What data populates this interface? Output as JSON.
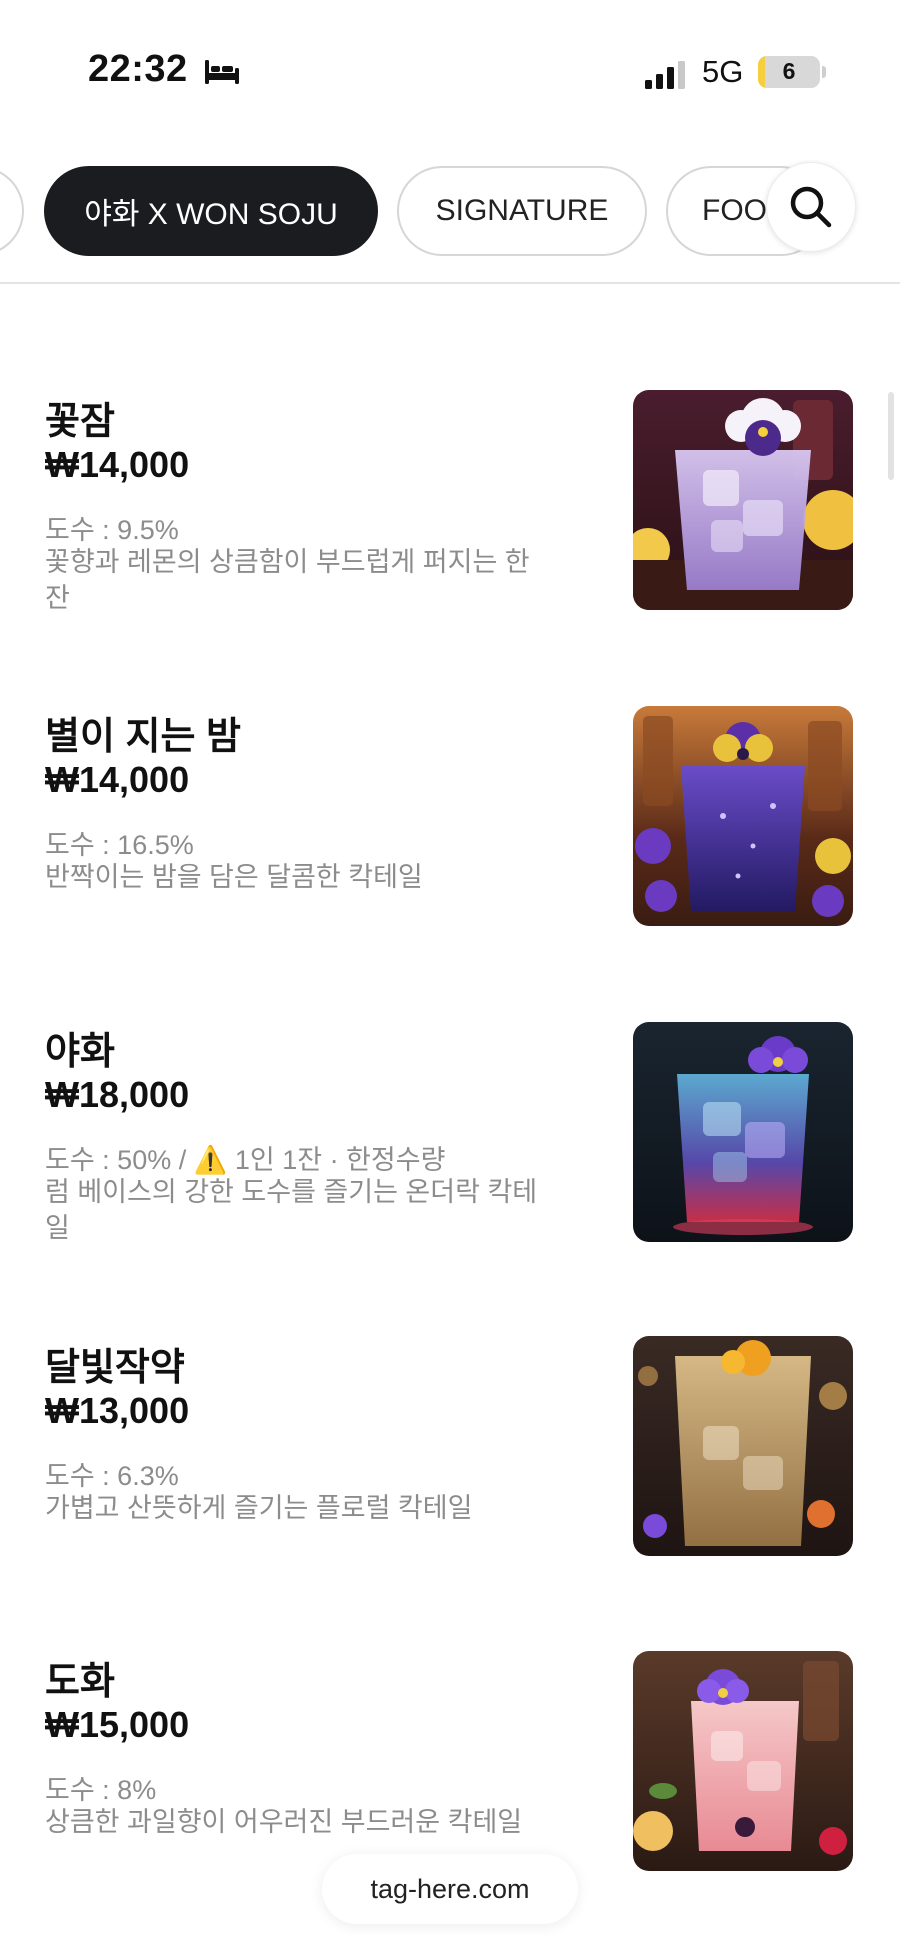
{
  "status_bar": {
    "time": "22:32",
    "network": "5G",
    "battery": "6",
    "battery_level": 0.06,
    "icons": [
      "bed-icon",
      "signal-icon",
      "battery-icon"
    ]
  },
  "tabs": [
    {
      "label": "",
      "active": false
    },
    {
      "label": "야화 X WON SOJU",
      "active": true
    },
    {
      "label": "SIGNATURE",
      "active": false
    },
    {
      "label": "FOO",
      "active": false
    }
  ],
  "search_icon": "search-icon",
  "menu": [
    {
      "name": "꽃잠",
      "price": "₩14,000",
      "abv": "도수 : 9.5%",
      "desc": "꽃향과 레몬의 상큼함이 부드럽게 퍼지는 한 잔",
      "image": "purple-lemon-cocktail"
    },
    {
      "name": "별이 지는 밤",
      "price": "₩14,000",
      "abv": "도수 : 16.5%",
      "desc": "반짝이는 밤을 담은 달콤한 칵테일",
      "image": "deep-purple-cocktail"
    },
    {
      "name": "야화",
      "price": "₩18,000",
      "abv": "도수 : 50% / ⚠️ 1인 1잔 · 한정수량",
      "desc": "럼 베이스의 강한 도수를 즐기는 온더락 칵테일",
      "image": "blue-violet-cocktail"
    },
    {
      "name": "달빛작약",
      "price": "₩13,000",
      "abv": "도수 : 6.3%",
      "desc": "가볍고 산뜻하게 즐기는 플로럴 칵테일",
      "image": "golden-cocktail"
    },
    {
      "name": "도화",
      "price": "₩15,000",
      "abv": "도수 : 8%",
      "desc": "상큼한 과일향이 어우러진 부드러운 칵테일",
      "image": "pink-fruit-cocktail"
    }
  ],
  "footer": {
    "label": "tag-here.com"
  },
  "colors": {
    "active_tab_bg": "#1a1c1f",
    "muted_text": "#8c8c8c",
    "battery_fill": "#f5cf3f"
  }
}
